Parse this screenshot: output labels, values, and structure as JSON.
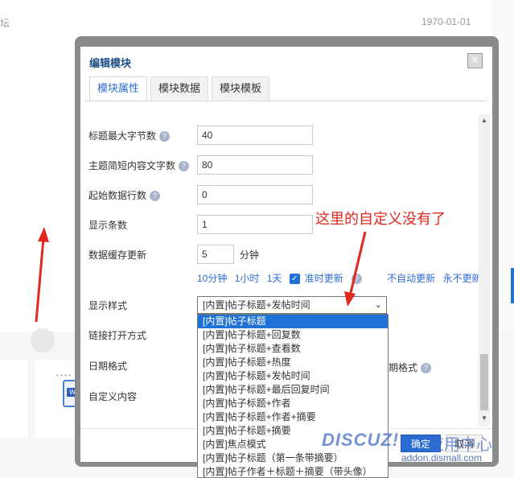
{
  "background": {
    "left_text": "坛",
    "date": "1970-01-01"
  },
  "dialog": {
    "title": "编辑模块",
    "close_icon": "close-icon",
    "tabs": [
      {
        "label": "模块属性",
        "active": true
      },
      {
        "label": "模块数据",
        "active": false
      },
      {
        "label": "模块模板",
        "active": false
      }
    ],
    "fields": {
      "title_max_bytes": {
        "label": "标题最大字节数",
        "value": "40"
      },
      "summary_length": {
        "label": "主题简短内容文字数",
        "value": "80"
      },
      "start_row": {
        "label": "起始数据行数",
        "value": "0"
      },
      "display_count": {
        "label": "显示条数",
        "value": "1"
      },
      "cache_update": {
        "label": "数据缓存更新",
        "value": "5",
        "unit": "分钟"
      }
    },
    "quick_links": [
      "10分钟",
      "1小时",
      "1天",
      "准时更新",
      "不自动更新",
      "永不更新"
    ],
    "on_time_checked": true,
    "display_style": {
      "label": "显示样式",
      "value": "[内置]帖子标题+发帖时间"
    },
    "link_open_mode": {
      "label": "链接打开方式"
    },
    "date_format": {
      "label": "日期格式",
      "tail": "期格式"
    },
    "custom_content": {
      "label": "自定义内容"
    },
    "buttons": {
      "ok": "确定",
      "cancel": "取消"
    }
  },
  "dropdown_options": [
    "[内置]帖子标题",
    "[内置]帖子标题+回复数",
    "[内置]帖子标题+查看数",
    "[内置]帖子标题+热度",
    "[内置]帖子标题+发帖时间",
    "[内置]帖子标题+最后回复时间",
    "[内置]帖子标题+作者",
    "[内置]帖子标题+作者+摘要",
    "[内置]帖子标题+摘要",
    "[内置]焦点模式",
    "[内置]帖子标题（第一条带摘要）",
    "[内置]帖子作者＋标题＋摘要（带头像）"
  ],
  "annotation": "这里的自定义没有了",
  "watermark": {
    "logo": "DISCUZ!",
    "cn": "应用中心",
    "url": "addon.dismall.com"
  }
}
